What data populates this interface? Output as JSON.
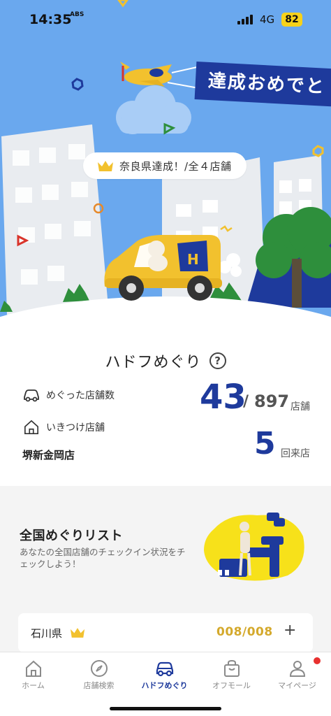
{
  "status_bar": {
    "time": "14:35",
    "time_sub": "ABS",
    "network": "4G",
    "battery": "82"
  },
  "hero": {
    "banner_text": "達成おめでと",
    "achievement": "奈良県達成！/全４店舗",
    "van_letter": "H",
    "colors": {
      "sky": "#6aa8ee",
      "navy": "#1e3a9c",
      "yellow": "#f2c12e",
      "green": "#2e8f3c"
    }
  },
  "stats": {
    "title": "ハドフめぐり",
    "help_icon": "?",
    "visited_label": "めぐった店舗数",
    "visited_count": "43",
    "separator": "/",
    "total_count": "897",
    "store_unit": "店舗",
    "frequent_label": "いきつけ店舗",
    "frequent_store": "堺新金岡店",
    "visit_count": "5",
    "visit_unit": "回来店"
  },
  "list": {
    "title": "全国めぐりリスト",
    "description": "あなたの全国店舗のチェックイン状況をチェックしよう！",
    "prefecture": {
      "name": "石川県",
      "progress": "008/008",
      "expand_symbol": "+"
    }
  },
  "tabs": [
    {
      "label": "ホーム",
      "icon": "home-icon"
    },
    {
      "label": "店舗検索",
      "icon": "compass-icon"
    },
    {
      "label": "ハドフめぐり",
      "icon": "car-icon",
      "active": true
    },
    {
      "label": "オフモール",
      "icon": "shopping-bag-icon"
    },
    {
      "label": "マイページ",
      "icon": "person-icon"
    }
  ]
}
